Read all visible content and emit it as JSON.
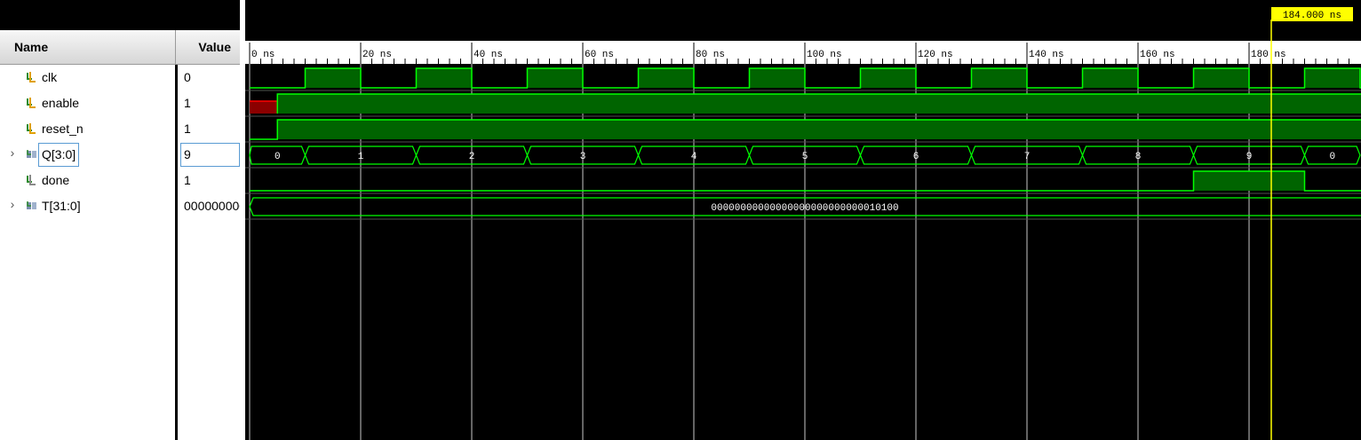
{
  "header": {
    "name_label": "Name",
    "value_label": "Value"
  },
  "signals": [
    {
      "name": "clk",
      "value": "0",
      "expandable": false,
      "icon": "scalar-signal-icon"
    },
    {
      "name": "enable",
      "value": "1",
      "expandable": false,
      "icon": "scalar-signal-icon"
    },
    {
      "name": "reset_n",
      "value": "1",
      "expandable": false,
      "icon": "scalar-signal-icon"
    },
    {
      "name": "Q[3:0]",
      "value": "9",
      "expandable": true,
      "icon": "bus-signal-icon",
      "selected": true
    },
    {
      "name": "done",
      "value": "1",
      "expandable": false,
      "icon": "scalar-signal-icon"
    },
    {
      "name": "T[31:0]",
      "value": "00000000000000000000000000010100",
      "expandable": true,
      "icon": "bus-signal-icon"
    }
  ],
  "timeline": {
    "unit": "ns",
    "start": 0,
    "ticks": [
      "0 ns",
      "20 ns",
      "40 ns",
      "60 ns",
      "80 ns",
      "100 ns",
      "120 ns",
      "140 ns",
      "160 ns",
      "180 ns"
    ],
    "cursor_label": "184.000 ns",
    "cursor_time": 184
  },
  "waves": {
    "clk_high_periods": [
      [
        10,
        20
      ],
      [
        30,
        40
      ],
      [
        50,
        60
      ],
      [
        70,
        80
      ],
      [
        90,
        100
      ],
      [
        110,
        120
      ],
      [
        130,
        140
      ],
      [
        150,
        160
      ],
      [
        170,
        180
      ],
      [
        190,
        200
      ]
    ],
    "enable_unknown_until": 5,
    "reset_n_rise": 5,
    "Q_segments": [
      {
        "label": "0",
        "start": 0,
        "end": 10
      },
      {
        "label": "1",
        "start": 10,
        "end": 30
      },
      {
        "label": "2",
        "start": 30,
        "end": 50
      },
      {
        "label": "3",
        "start": 50,
        "end": 70
      },
      {
        "label": "4",
        "start": 70,
        "end": 90
      },
      {
        "label": "5",
        "start": 90,
        "end": 110
      },
      {
        "label": "6",
        "start": 110,
        "end": 130
      },
      {
        "label": "7",
        "start": 130,
        "end": 150
      },
      {
        "label": "8",
        "start": 150,
        "end": 170
      },
      {
        "label": "9",
        "start": 170,
        "end": 190
      },
      {
        "label": "0",
        "start": 190,
        "end": 200
      }
    ],
    "done_high": [
      170,
      190
    ],
    "T_value": "00000000000000000000000000010100"
  },
  "colors": {
    "wave_green": "#00ff00",
    "wave_fill": "#006400",
    "unknown_red": "#ff0000",
    "cursor": "#ffff00",
    "grid": "#c8c8c8"
  }
}
